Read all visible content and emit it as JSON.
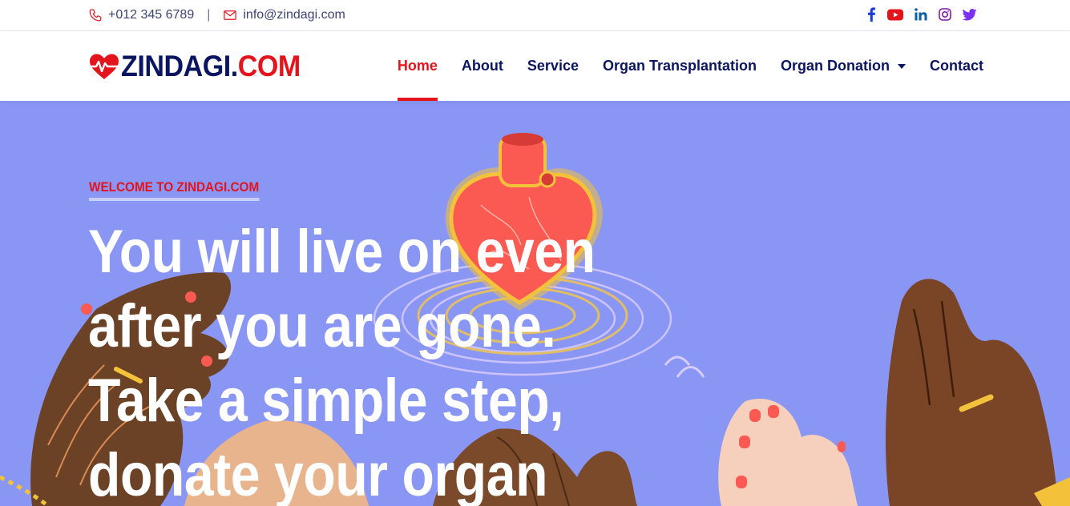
{
  "topbar": {
    "phone": "+012 345 6789",
    "separator": "|",
    "email": "info@zindagi.com",
    "phone_icon": "phone-icon",
    "email_icon": "envelope-icon",
    "social": [
      {
        "name": "facebook-icon",
        "glyph": "f",
        "color": "#1a3bd6"
      },
      {
        "name": "youtube-icon",
        "glyph": "▶",
        "color": "#e4141d"
      },
      {
        "name": "linkedin-icon",
        "glyph": "in",
        "color": "#0b5fa5"
      },
      {
        "name": "instagram-icon",
        "glyph": "◎",
        "color": "#7a1ea8"
      },
      {
        "name": "twitter-icon",
        "glyph": "t",
        "color": "#7b2ff2"
      }
    ]
  },
  "brand": {
    "name_part1": "ZINDAGI.",
    "name_part2": "COM",
    "logo_icon": "heartbeat-icon"
  },
  "nav": {
    "items": [
      {
        "label": "Home",
        "active": true
      },
      {
        "label": "About"
      },
      {
        "label": "Service"
      },
      {
        "label": "Organ Transplantation"
      },
      {
        "label": "Organ Donation",
        "dropdown": true
      },
      {
        "label": "Contact"
      }
    ]
  },
  "hero": {
    "kicker": "WELCOME TO ZINDAGI.COM",
    "headline_lines": [
      "You will live on even",
      "after you are gone.",
      "Take a simple step,",
      "donate your organ"
    ]
  },
  "colors": {
    "brand_navy": "#0b1560",
    "brand_red": "#e4141d",
    "hero_bg": "#8a96f4"
  }
}
